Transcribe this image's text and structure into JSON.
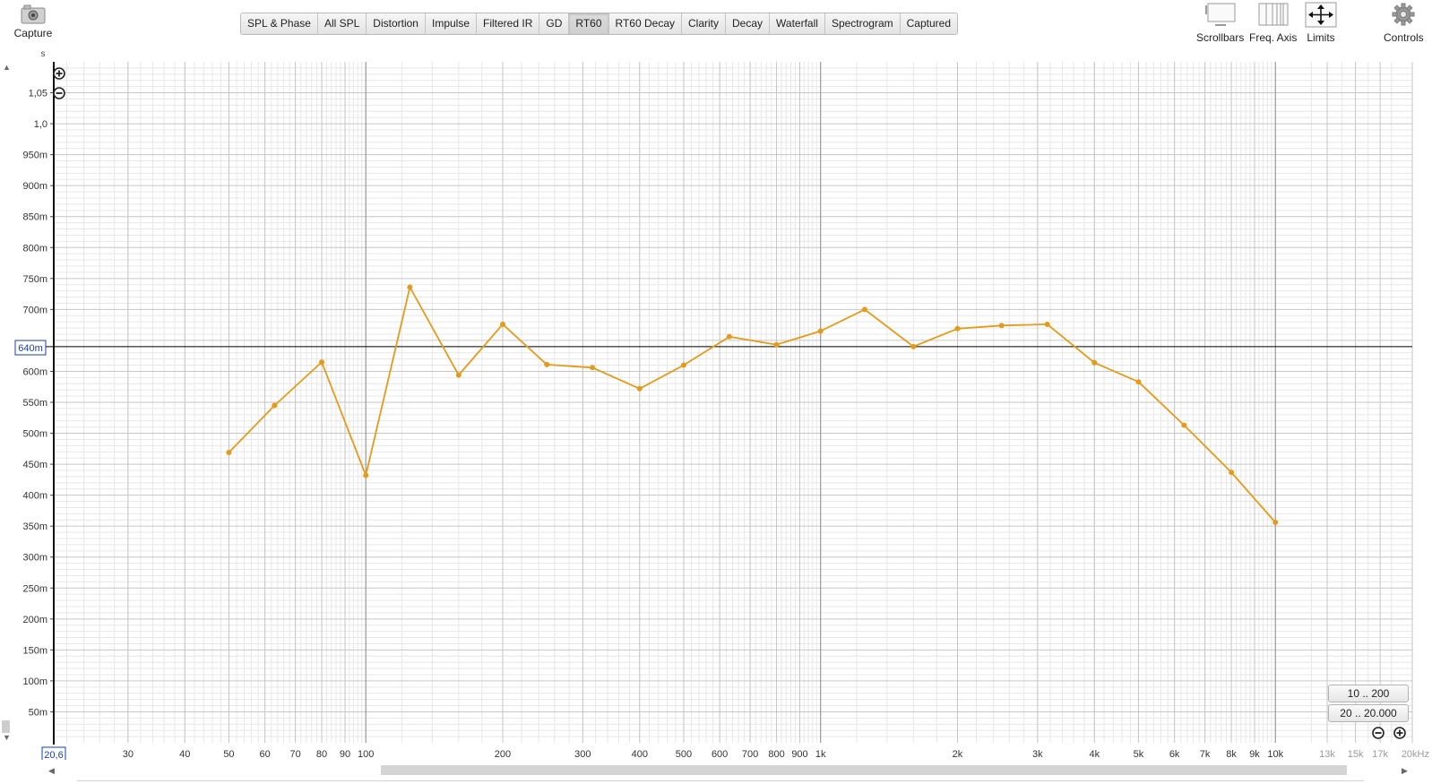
{
  "toolbar": {
    "capture": {
      "label": "Capture",
      "icon": "camera-icon"
    },
    "tabs": [
      {
        "label": "SPL & Phase",
        "active": false
      },
      {
        "label": "All SPL",
        "active": false
      },
      {
        "label": "Distortion",
        "active": false
      },
      {
        "label": "Impulse",
        "active": false
      },
      {
        "label": "Filtered IR",
        "active": false
      },
      {
        "label": "GD",
        "active": false
      },
      {
        "label": "RT60",
        "active": true
      },
      {
        "label": "RT60 Decay",
        "active": false
      },
      {
        "label": "Clarity",
        "active": false
      },
      {
        "label": "Decay",
        "active": false
      },
      {
        "label": "Waterfall",
        "active": false
      },
      {
        "label": "Spectrogram",
        "active": false
      },
      {
        "label": "Captured",
        "active": false
      }
    ],
    "right_tools": [
      {
        "label": "Scrollbars",
        "icon": "scrollbars-icon"
      },
      {
        "label": "Freq. Axis",
        "icon": "freq-axis-icon"
      },
      {
        "label": "Limits",
        "icon": "limits-arrows-icon"
      },
      {
        "label": "Controls",
        "icon": "gear-icon"
      }
    ]
  },
  "range_buttons": {
    "low": "10 .. 200",
    "full": "20 .. 20.000"
  },
  "colors": {
    "series": "#E39B1B",
    "grid_major": "#c6c6c6",
    "grid_minor": "#e7e7e7",
    "cursor": "#000000",
    "readout": "#1a3fa8"
  },
  "chart_data": {
    "type": "line",
    "title": "",
    "xlabel": "",
    "ylabel": "s",
    "x_scale": "log",
    "xlim": [
      20.6,
      20000
    ],
    "ylim": [
      0,
      1.1
    ],
    "grid": true,
    "cursor_readout": {
      "y": "640m",
      "x": "20,6"
    },
    "y_ticks": [
      {
        "v": 1.05,
        "label": "1,05"
      },
      {
        "v": 1.0,
        "label": "1,0"
      },
      {
        "v": 0.95,
        "label": "950m"
      },
      {
        "v": 0.9,
        "label": "900m"
      },
      {
        "v": 0.85,
        "label": "850m"
      },
      {
        "v": 0.8,
        "label": "800m"
      },
      {
        "v": 0.75,
        "label": "750m"
      },
      {
        "v": 0.7,
        "label": "700m"
      },
      {
        "v": 0.6,
        "label": "600m"
      },
      {
        "v": 0.55,
        "label": "550m"
      },
      {
        "v": 0.5,
        "label": "500m"
      },
      {
        "v": 0.45,
        "label": "450m"
      },
      {
        "v": 0.4,
        "label": "400m"
      },
      {
        "v": 0.35,
        "label": "350m"
      },
      {
        "v": 0.3,
        "label": "300m"
      },
      {
        "v": 0.25,
        "label": "250m"
      },
      {
        "v": 0.2,
        "label": "200m"
      },
      {
        "v": 0.15,
        "label": "150m"
      },
      {
        "v": 0.1,
        "label": "100m"
      },
      {
        "v": 0.05,
        "label": "50m"
      }
    ],
    "x_ticks": [
      {
        "v": 30,
        "label": "30"
      },
      {
        "v": 40,
        "label": "40"
      },
      {
        "v": 50,
        "label": "50"
      },
      {
        "v": 60,
        "label": "60"
      },
      {
        "v": 70,
        "label": "70"
      },
      {
        "v": 80,
        "label": "80"
      },
      {
        "v": 90,
        "label": "90"
      },
      {
        "v": 100,
        "label": "100"
      },
      {
        "v": 200,
        "label": "200"
      },
      {
        "v": 300,
        "label": "300"
      },
      {
        "v": 400,
        "label": "400"
      },
      {
        "v": 500,
        "label": "500"
      },
      {
        "v": 600,
        "label": "600"
      },
      {
        "v": 700,
        "label": "700"
      },
      {
        "v": 800,
        "label": "800"
      },
      {
        "v": 900,
        "label": "900"
      },
      {
        "v": 1000,
        "label": "1k"
      },
      {
        "v": 2000,
        "label": "2k"
      },
      {
        "v": 3000,
        "label": "3k"
      },
      {
        "v": 4000,
        "label": "4k"
      },
      {
        "v": 5000,
        "label": "5k"
      },
      {
        "v": 6000,
        "label": "6k"
      },
      {
        "v": 7000,
        "label": "7k"
      },
      {
        "v": 8000,
        "label": "8k"
      },
      {
        "v": 9000,
        "label": "9k"
      },
      {
        "v": 10000,
        "label": "10k"
      },
      {
        "v": 13000,
        "label": "13k"
      },
      {
        "v": 15000,
        "label": "15k"
      },
      {
        "v": 17000,
        "label": "17k"
      },
      {
        "v": 20000,
        "label": "20kHz"
      }
    ],
    "series": [
      {
        "x": [
          50,
          63,
          80,
          100,
          125,
          160,
          200,
          250,
          315,
          400,
          500,
          630,
          800,
          1000,
          1250,
          1600,
          2000,
          2500,
          3150,
          4000,
          5000,
          6300,
          8000,
          10000
        ],
        "y": [
          0.469,
          0.545,
          0.615,
          0.432,
          0.736,
          0.594,
          0.676,
          0.611,
          0.606,
          0.572,
          0.61,
          0.656,
          0.643,
          0.665,
          0.7,
          0.64,
          0.669,
          0.674,
          0.676,
          0.614,
          0.583,
          0.513,
          0.437,
          0.356
        ]
      }
    ]
  }
}
